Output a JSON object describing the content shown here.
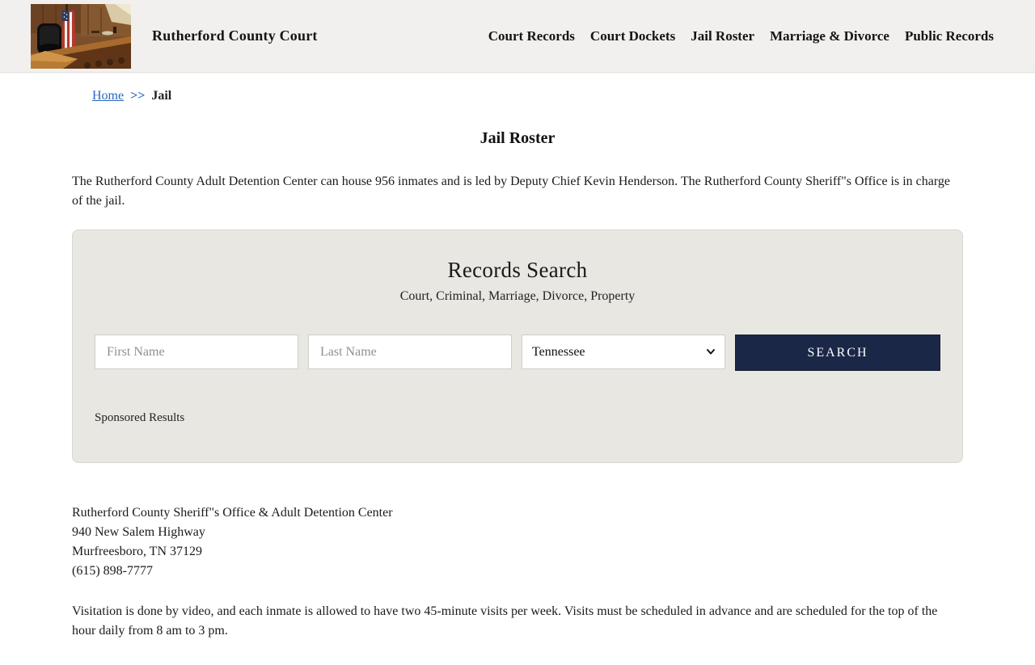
{
  "header": {
    "brand": "Rutherford County Court",
    "nav_items": [
      {
        "label": "Court Records"
      },
      {
        "label": "Court Dockets"
      },
      {
        "label": "Jail Roster"
      },
      {
        "label": "Marriage & Divorce"
      },
      {
        "label": "Public Records"
      }
    ]
  },
  "breadcrumb": {
    "home": "Home",
    "separator": ">>",
    "current": "Jail"
  },
  "page": {
    "title": "Jail Roster",
    "intro": "The Rutherford County Adult Detention Center can house 956 inmates and is led by Deputy Chief Kevin Henderson. The Rutherford County Sheriff\"s Office is in charge of the jail."
  },
  "search": {
    "title": "Records Search",
    "subtitle": "Court, Criminal, Marriage, Divorce, Property",
    "first_name_placeholder": "First Name",
    "last_name_placeholder": "Last Name",
    "state_selected": "Tennessee",
    "button_label": "SEARCH",
    "sponsored_label": "Sponsored Results",
    "button_color": "#1b2747"
  },
  "contact": {
    "lines": [
      "Rutherford County Sheriff\"s Office & Adult Detention Center",
      "940 New Salem Highway",
      "Murfreesboro, TN 37129",
      "(615) 898-7777"
    ]
  },
  "visitation": "Visitation is done by video, and each inmate is allowed to have two 45-minute visits per week. Visits must be scheduled in advance and are scheduled for the top of the hour daily from 8 am to 3 pm.",
  "colors": {
    "link": "#2a66c0",
    "header_bg": "#f1f0ee",
    "panel_bg": "#e8e7e2"
  }
}
